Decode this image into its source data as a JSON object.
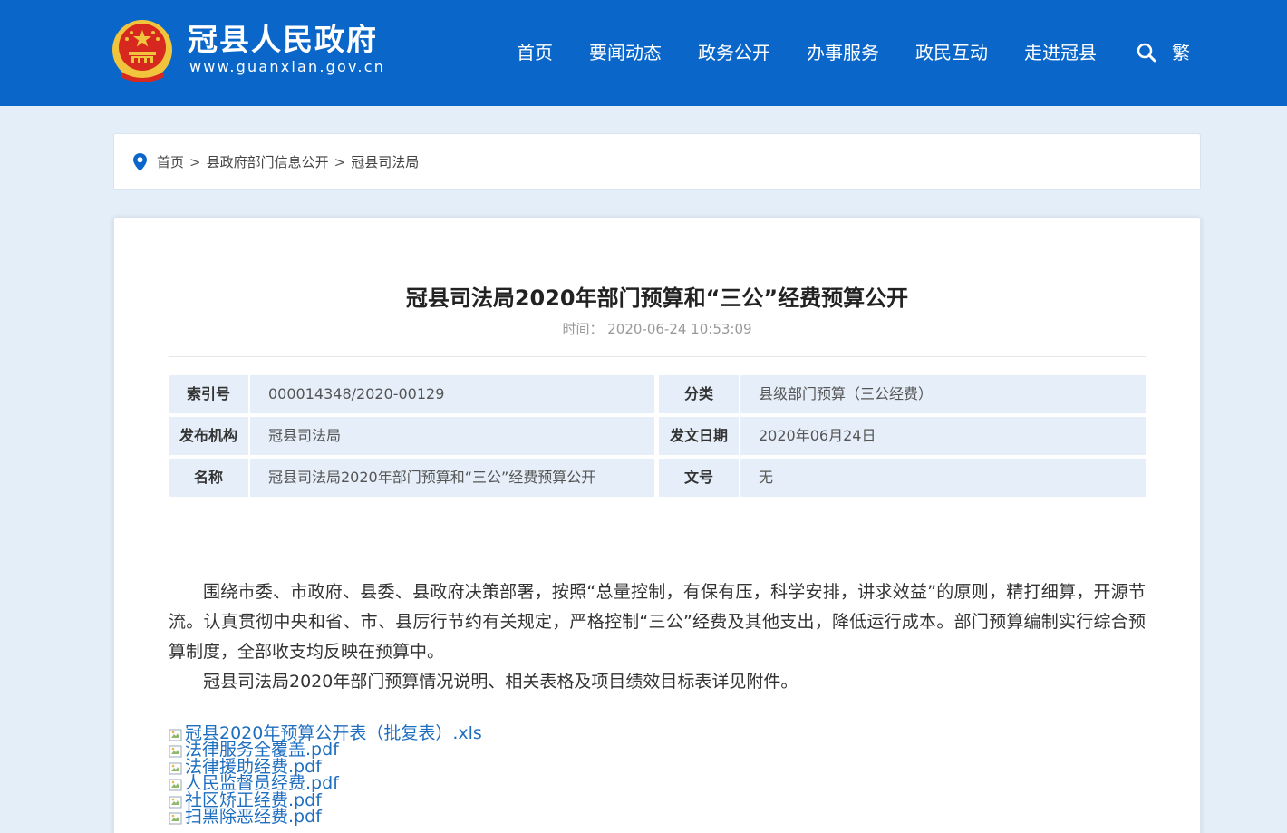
{
  "header": {
    "site_title": "冠县人民政府",
    "site_url": "www.guanxian.gov.cn",
    "nav": [
      "首页",
      "要闻动态",
      "政务公开",
      "办事服务",
      "政民互动",
      "走进冠县"
    ],
    "traditional_label": "繁",
    "colors": {
      "bar": "#0a67c9",
      "emblem_red": "#d7281f",
      "emblem_gold": "#f0c43c"
    }
  },
  "breadcrumb": {
    "items": [
      "首页",
      "县政府部门信息公开",
      "冠县司法局"
    ],
    "separator": ">"
  },
  "article": {
    "title": "冠县司法局2020年部门预算和“三公”经费预算公开",
    "time_label": "时间：",
    "time": "2020-06-24 10:53:09",
    "info": {
      "rows": [
        {
          "label1": "索引号",
          "value1": "000014348/2020-00129",
          "label2": "分类",
          "value2": "县级部门预算（三公经费）"
        },
        {
          "label1": "发布机构",
          "value1": "冠县司法局",
          "label2": "发文日期",
          "value2": "2020年06月24日"
        },
        {
          "label1": "名称",
          "value1": "冠县司法局2020年部门预算和“三公”经费预算公开",
          "label2": "文号",
          "value2": "无"
        }
      ]
    },
    "paragraphs": [
      "围绕市委、市政府、县委、县政府决策部署，按照“总量控制，有保有压，科学安排，讲求效益”的原则，精打细算，开源节流。认真贯彻中央和省、市、县厉行节约有关规定，严格控制“三公”经费及其他支出，降低运行成本。部门预算编制实行综合预算制度，全部收支均反映在预算中。",
      "冠县司法局2020年部门预算情况说明、相关表格及项目绩效目标表详见附件。"
    ],
    "attachments": [
      "冠县2020年预算公开表（批复表）.xls",
      "法律服务全覆盖.pdf",
      "法律援助经费.pdf",
      "人民监督员经费.pdf",
      "社区矫正经费.pdf",
      "扫黑除恶经费.pdf"
    ]
  }
}
